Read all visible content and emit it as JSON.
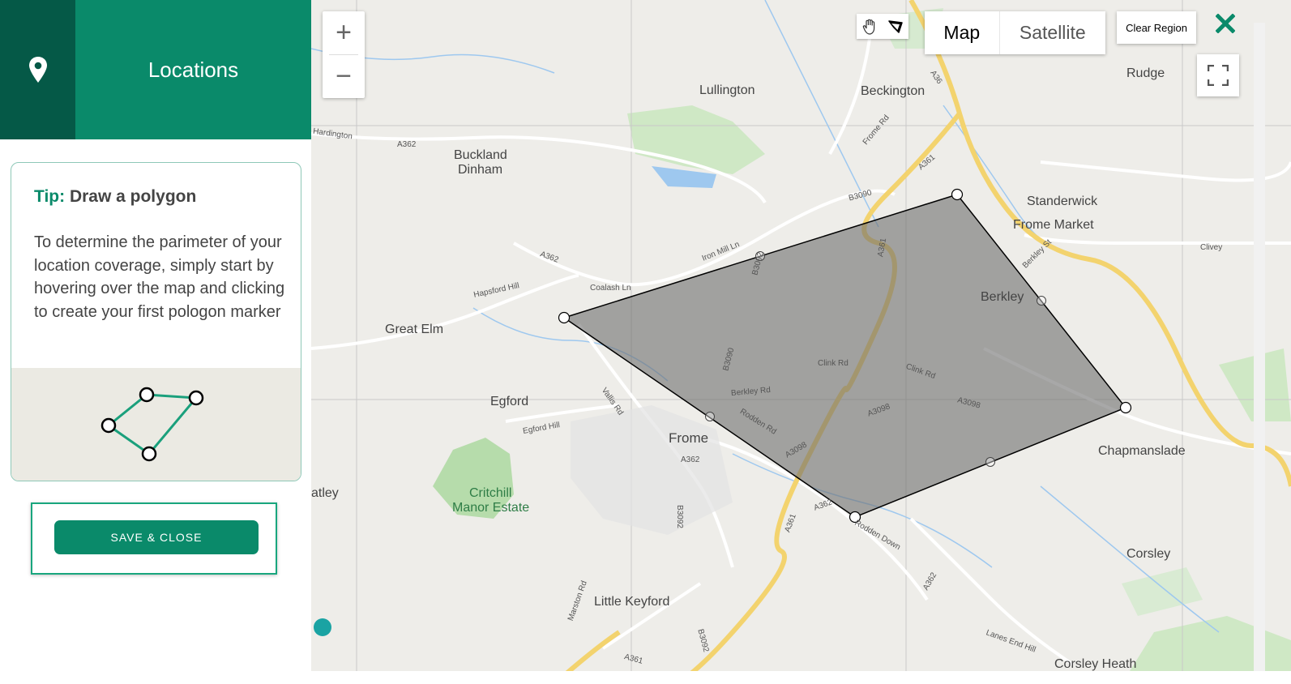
{
  "sidebar": {
    "header": {
      "title": "Locations",
      "icon": "map-pin-icon"
    },
    "tip": {
      "label": "Tip:",
      "title": "Draw a polygon",
      "body": "To determine the parimeter of your location coverage, simply start by hovering over the map and clicking to create your first pologon marker"
    },
    "save_button": "SAVE & CLOSE"
  },
  "map": {
    "zoom_in": "+",
    "zoom_out": "−",
    "map_type": {
      "map": "Map",
      "satellite": "Satellite"
    },
    "clear_region": "Clear Region",
    "places": {
      "lullington": "Lullington",
      "beckington": "Beckington",
      "rudge": "Rudge",
      "buckland": "Buckland",
      "dinham": "Dinham",
      "standerwick": "Standerwick",
      "frome_market": "Frome Market",
      "berkley": "Berkley",
      "great_elm": "Great Elm",
      "egford": "Egford",
      "frome": "Frome",
      "chapmanslade": "Chapmanslade",
      "critchill": "Critchill",
      "manor_estate": "Manor Estate",
      "corsley": "Corsley",
      "little_keyford": "Little Keyford",
      "corsley_heath": "Corsley Heath",
      "atley": "atley"
    },
    "roads": {
      "hardington": "Hardington",
      "a362_top": "A362",
      "a36": "A36",
      "frome_rd": "Frome Rd",
      "a361_top": "A361",
      "b3090_top": "B3090",
      "iron_mill_ln": "Iron Mill Ln",
      "a362_left": "A362",
      "coalash_ln": "Coalash Ln",
      "hapsford_hill": "Hapsford Hill",
      "b3092_top": "B3092",
      "a361_mid": "A361",
      "berkley_st": "Berkley St",
      "clivey": "Clivey",
      "b3090_mid": "B3090",
      "clink_rd_1": "Clink Rd",
      "clink_rd_2": "Clink Rd",
      "berkley_rd": "Berkley Rd",
      "vallis_rd": "Vallis Rd",
      "rodden_rd": "Rodden Rd",
      "a3098_1": "A3098",
      "a3098_2": "A3098",
      "a3098_3": "A3098",
      "egford_hill": "Egford Hill",
      "a362_frome": "A362",
      "b3092_mid": "B3092",
      "a361_low": "A361",
      "a362_low": "A362",
      "rodden_down": "Rodden Down",
      "a362_right": "A362",
      "marston_rd": "Marston Rd",
      "b3092_low": "B3092",
      "lanes_end_hill": "Lanes End Hill",
      "a361_bottom": "A361"
    }
  },
  "colors": {
    "brand": "#0a8a6a",
    "brand_dark": "#055947",
    "close": "#0a8a6a",
    "polygon_fill": "#6e6e6e"
  }
}
